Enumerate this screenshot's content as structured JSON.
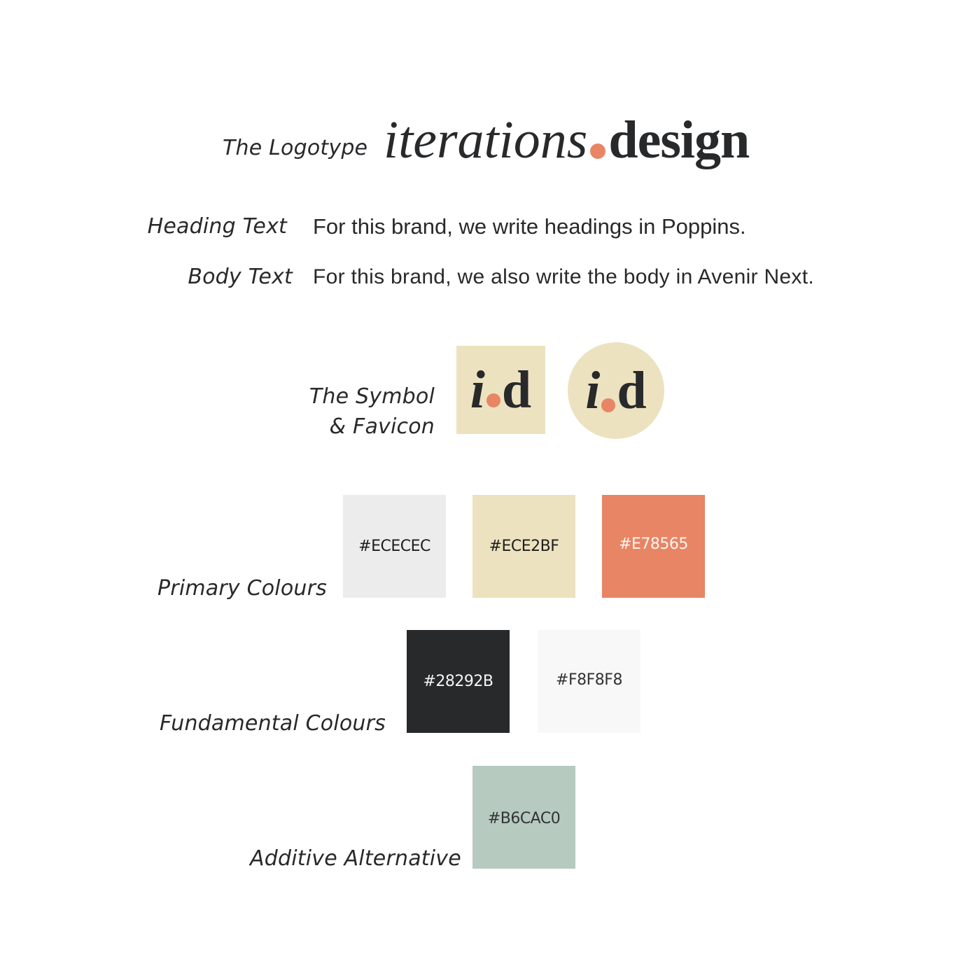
{
  "logotype": {
    "label": "The Logotype",
    "word_part": "iterations",
    "domain_part": "design"
  },
  "typography": {
    "heading": {
      "label": "Heading Text",
      "sample": "For this brand, we write headings in Poppins."
    },
    "body": {
      "label": "Body Text",
      "sample": "For this brand, we also write the body in Avenir Next."
    }
  },
  "symbol": {
    "label_line1": "The Symbol",
    "label_line2": "& Favicon",
    "glyph_i": "i",
    "glyph_d": "d"
  },
  "colours": {
    "primary": {
      "label": "Primary Colours",
      "swatches": [
        {
          "hex": "#ECECEC"
        },
        {
          "hex": "#ECE2BF"
        },
        {
          "hex": "#E78565"
        }
      ]
    },
    "fundamental": {
      "label": "Fundamental Colours",
      "swatches": [
        {
          "hex": "#28292B"
        },
        {
          "hex": "#F8F8F8"
        }
      ]
    },
    "additive": {
      "label": "Additive Alternative",
      "swatches": [
        {
          "hex": "#B6CAC0"
        }
      ]
    }
  },
  "brand_colors": {
    "accent": "#E78565",
    "dark": "#28292B",
    "cream": "#ECE2BF"
  }
}
